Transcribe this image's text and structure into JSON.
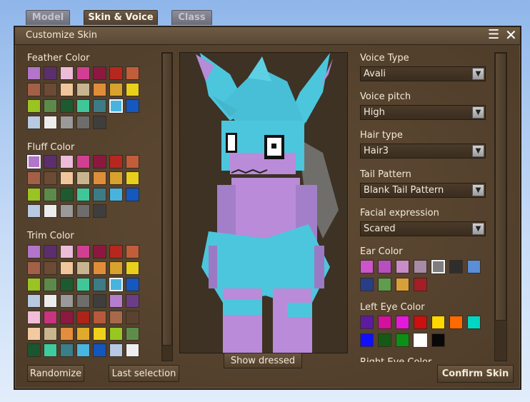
{
  "tabs": [
    {
      "label": "Model",
      "active": false
    },
    {
      "label": "Skin & Voice",
      "active": true
    },
    {
      "label": "Class",
      "active": false
    }
  ],
  "window": {
    "title": "Customize Skin",
    "menu_icon": "menu-icon",
    "close_icon": "close-icon"
  },
  "palette_sections": [
    {
      "label": "Feather Color",
      "selected_index": 19,
      "colors": [
        "#b275c9",
        "#5b2f6e",
        "#ecbcd9",
        "#d13f93",
        "#8c1840",
        "#b7271f",
        "#c05d3b",
        "#a36048",
        "#6b4a36",
        "#f0c79c",
        "#c8b590",
        "#e08d3a",
        "#d9a22c",
        "#e8cf1b",
        "#9ac421",
        "#5c8a4a",
        "#1e5a30",
        "#3fc79a",
        "#3b7c86",
        "#48b3df",
        "#1458c0",
        "#b8c9e2",
        "#ececec",
        "#9a9a9a",
        "#6d6d6d",
        "#3e3e3e"
      ]
    },
    {
      "label": "Fluff Color",
      "selected_index": 0,
      "colors": [
        "#b275c9",
        "#5b2f6e",
        "#ecbcd9",
        "#d13f93",
        "#8c1840",
        "#b7271f",
        "#c05d3b",
        "#a36048",
        "#6b4a36",
        "#f0c79c",
        "#c8b590",
        "#e08d3a",
        "#d9a22c",
        "#e8cf1b",
        "#9ac421",
        "#5c8a4a",
        "#1e5a30",
        "#3fc79a",
        "#3b7c86",
        "#48b3df",
        "#1458c0",
        "#b8c9e2",
        "#ececec",
        "#9a9a9a",
        "#6d6d6d",
        "#3e3e3e"
      ]
    },
    {
      "label": "Trim Color",
      "selected_index": 19,
      "colors": [
        "#b275c9",
        "#5b2f6e",
        "#ecbcd9",
        "#d13f93",
        "#8c1840",
        "#b7271f",
        "#c05d3b",
        "#a36048",
        "#6b4a36",
        "#f0c79c",
        "#c8b590",
        "#e08d3a",
        "#d9a22c",
        "#e8cf1b",
        "#9ac421",
        "#5c8a4a",
        "#1e5a30",
        "#3fc79a",
        "#3b7c86",
        "#48b3df",
        "#1458c0",
        "#b8c9e2",
        "#ececec",
        "#9a9a9a",
        "#6d6d6d",
        "#3e3e3e",
        "#b47dd0",
        "#6a3d86",
        "#f1bcd8",
        "#c9337f",
        "#8d1840",
        "#ad2319",
        "#b65a3b",
        "#a8684c",
        "#5b4230",
        "#f3c9a0",
        "#c9b58e",
        "#e48d3c",
        "#e0aa2a",
        "#eed11c",
        "#98c722",
        "#5f8c4b",
        "#1a5630",
        "#3ecb9e",
        "#397e88",
        "#49b5e1",
        "#1256c0",
        "#b6c8e4",
        "#eeeeee"
      ]
    }
  ],
  "preview": {
    "show_dressed_label": "Show dressed"
  },
  "right_fields": [
    {
      "label": "Voice Type",
      "value": "Avali"
    },
    {
      "label": "Voice pitch",
      "value": "High"
    },
    {
      "label": "Hair type",
      "value": "Hair3"
    },
    {
      "label": "Tail Pattern",
      "value": "Blank Tail Pattern"
    },
    {
      "label": "Facial expression",
      "value": "Scared"
    }
  ],
  "ear_color": {
    "label": "Ear Color",
    "selected_index": 4,
    "colors": [
      "#cc55cc",
      "#b84fbf",
      "#c98cc9",
      "#a88aa6",
      "#7d7d7d",
      "#2e2e2e",
      "#5a8ed6",
      "#283e86",
      "#5e9c4e",
      "#d9a03a",
      "#a31f25"
    ]
  },
  "left_eye_color": {
    "label": "Left Eye Color",
    "selected_index": 10,
    "colors": [
      "#5d1ca0",
      "#d4109e",
      "#e519d9",
      "#cc0f0f",
      "#ffd800",
      "#ff6a00",
      "#00d7c2",
      "#1010ff",
      "#145a14",
      "#0b8f16",
      "#ffffff",
      "#080808"
    ]
  },
  "right_eye_partial_label": "Right Eye Color",
  "buttons": {
    "randomize": "Randomize",
    "last_selection": "Last selection",
    "confirm": "Confirm Skin"
  }
}
